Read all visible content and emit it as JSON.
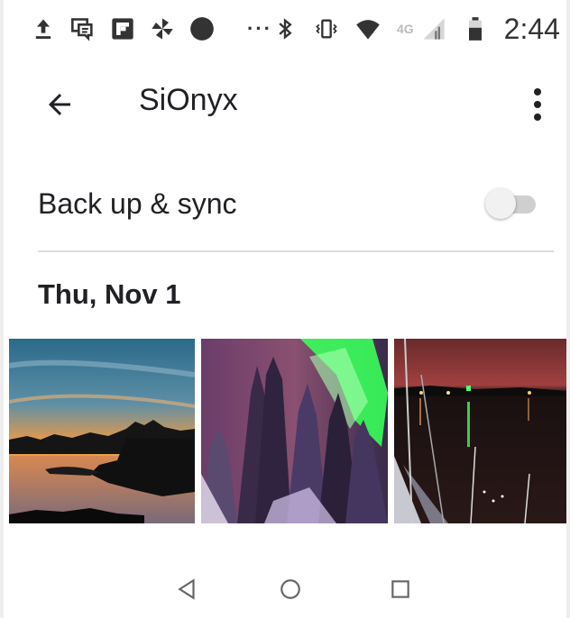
{
  "status_bar": {
    "icons": [
      "upload-icon",
      "chat-icon",
      "flipboard-icon",
      "pinwheel-icon",
      "record-dot-icon"
    ],
    "more": "···",
    "right_icons": [
      "bluetooth-icon",
      "vibrate-icon",
      "wifi-icon",
      "cell-signal-icon",
      "battery-icon"
    ],
    "network": "4G",
    "time": "2:44"
  },
  "app_bar": {
    "back_icon": "arrow-back-icon",
    "title": "SiOnyx",
    "overflow_icon": "more-vert-icon"
  },
  "backup": {
    "label": "Back up & sync",
    "toggle_on": false
  },
  "section": {
    "date": "Thu, Nov 1"
  },
  "photos": [
    {
      "name": "sunset-shoreline-photo"
    },
    {
      "name": "aurora-forest-photo"
    },
    {
      "name": "night-harbor-photo"
    }
  ],
  "nav": {
    "back_icon": "nav-back-triangle-icon",
    "home_icon": "nav-home-circle-icon",
    "recent_icon": "nav-recent-square-icon"
  },
  "colors": {
    "text": "#202124",
    "divider": "#dcdcdc",
    "toggle_track": "#cfcfcf"
  }
}
